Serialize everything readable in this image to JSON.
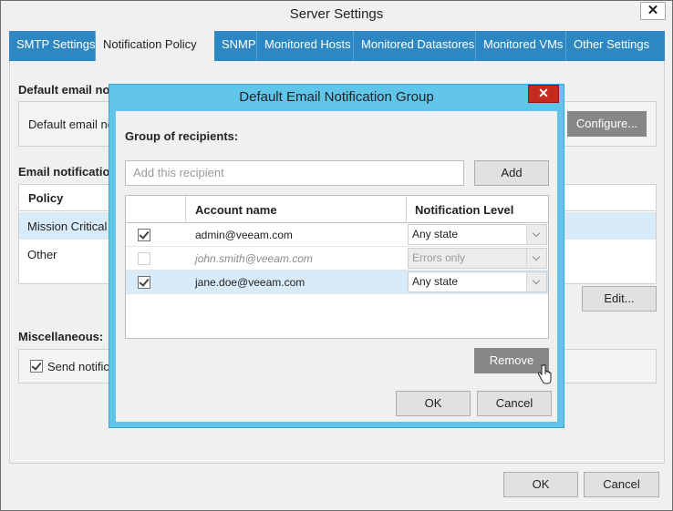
{
  "window": {
    "title": "Server Settings",
    "close_glyph": "✕"
  },
  "tabs": [
    {
      "label": "SMTP Settings"
    },
    {
      "label": "Notification Policy"
    },
    {
      "label": "SNMP"
    },
    {
      "label": "Monitored Hosts"
    },
    {
      "label": "Monitored Datastores"
    },
    {
      "label": "Monitored VMs"
    },
    {
      "label": "Other Settings"
    }
  ],
  "default_email": {
    "heading": "Default email no",
    "field_label": "Default email no",
    "configure_button": "Configure..."
  },
  "policies": {
    "heading": "Email notification",
    "column_policy": "Policy",
    "rows": [
      {
        "label": "Mission Critical"
      },
      {
        "label": "Other"
      }
    ],
    "edit_button": "Edit..."
  },
  "misc": {
    "heading": "Miscellaneous:",
    "checkbox_label": "Send notifica"
  },
  "footer": {
    "ok": "OK",
    "cancel": "Cancel"
  },
  "dialog": {
    "title": "Default Email Notification Group",
    "close_glyph": "✕",
    "group_label": "Group of recipients:",
    "recipient_placeholder": "Add this recipient",
    "add_button": "Add",
    "columns": {
      "account": "Account name",
      "level": "Notification Level"
    },
    "recipients": [
      {
        "account": "admin@veeam.com",
        "level": "Any state",
        "checked": true,
        "enabled": true
      },
      {
        "account": "john.smith@veeam.com",
        "level": "Errors only",
        "checked": false,
        "enabled": false
      },
      {
        "account": "jane.doe@veeam.com",
        "level": "Any state",
        "checked": true,
        "enabled": true
      }
    ],
    "remove_button": "Remove",
    "ok_button": "OK",
    "cancel_button": "Cancel"
  },
  "icons": {
    "cursor": "hand-pointer-icon",
    "dropdown": "chevron-down-icon",
    "close": "close-icon"
  }
}
